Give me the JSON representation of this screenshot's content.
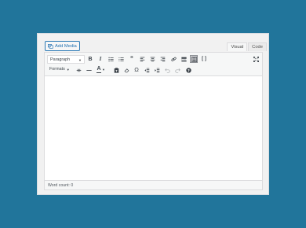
{
  "add_media": {
    "label": "Add Media",
    "icon": "add-media-icon"
  },
  "tabs": [
    {
      "label": "Visual",
      "active": true
    },
    {
      "label": "Code",
      "active": false
    }
  ],
  "toolbar": {
    "format_select": "Paragraph",
    "formats_menu": "Formats",
    "text_color": "A",
    "special_char": "Ω"
  },
  "editor": {
    "content": ""
  },
  "status": {
    "word_count": "Word count: 0"
  },
  "colors": {
    "background": "#21759b",
    "link": "#2271b1",
    "toolbar": "#f6f7f7"
  }
}
